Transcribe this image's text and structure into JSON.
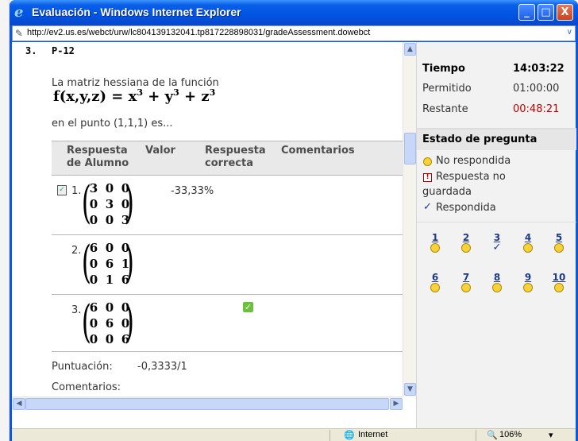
{
  "window": {
    "title": "Evaluación - Windows Internet Explorer",
    "minimize": "_",
    "maximize": "□",
    "close": "X"
  },
  "address": {
    "url": "http://ev2.us.es/webct/urw/lc804139132041.tp817228898031/gradeAssessment.dowebct"
  },
  "question": {
    "number": "3.",
    "id": "P-12",
    "text1": "La matriz hessiana de la función",
    "formula_fxyz": "f(x,y,z) = x",
    "formula_y": " + y",
    "formula_z": " + z",
    "formula_exp": "3",
    "text2": "en el punto (1,1,1) es...",
    "table": {
      "headers": {
        "student_answer": [
          "Respuesta",
          "de Alumno"
        ],
        "value": "Valor",
        "correct_answer": [
          "Respuesta",
          "correcta"
        ],
        "comments": "Comentarios"
      },
      "rows": [
        {
          "num": "1.",
          "matrix": [
            [
              "3",
              "0",
              "0"
            ],
            [
              "0",
              "3",
              "0"
            ],
            [
              "0",
              "0",
              "3"
            ]
          ],
          "value": "-33,33%",
          "selected": true,
          "correct": false
        },
        {
          "num": "2.",
          "matrix": [
            [
              "6",
              "0",
              "0"
            ],
            [
              "0",
              "6",
              "1"
            ],
            [
              "0",
              "1",
              "6"
            ]
          ],
          "value": "",
          "selected": false,
          "correct": false
        },
        {
          "num": "3.",
          "matrix": [
            [
              "6",
              "0",
              "0"
            ],
            [
              "0",
              "6",
              "0"
            ],
            [
              "0",
              "0",
              "6"
            ]
          ],
          "value": "",
          "selected": false,
          "correct": true
        }
      ]
    },
    "score_label": "Puntuación:",
    "score_value": "-0,3333/1",
    "comments_label": "Comentarios:"
  },
  "side": {
    "time_label": "Tiempo",
    "time_value": "14:03:22",
    "allowed_label": "Permitido",
    "allowed_value": "01:00:00",
    "remaining_label": "Restante",
    "remaining_value": "00:48:21",
    "status_title": "Estado de pregunta",
    "legend_unanswered": "No respondida",
    "legend_unsaved_1": "Respuesta no",
    "legend_unsaved_2": "guardada",
    "legend_answered": "Respondida",
    "questions": [
      {
        "num": "1",
        "state": "unanswered"
      },
      {
        "num": "2",
        "state": "unanswered"
      },
      {
        "num": "3",
        "state": "answered"
      },
      {
        "num": "4",
        "state": "unanswered"
      },
      {
        "num": "5",
        "state": "unanswered"
      },
      {
        "num": "6",
        "state": "unanswered"
      },
      {
        "num": "7",
        "state": "unanswered"
      },
      {
        "num": "8",
        "state": "unanswered"
      },
      {
        "num": "9",
        "state": "unanswered"
      },
      {
        "num": "10",
        "state": "unanswered"
      }
    ]
  },
  "statusbar": {
    "zone": "Internet",
    "zoom": "106%"
  },
  "colors": {
    "titlebar": "#0054e3",
    "remaining": "#c00000",
    "link": "#1e3a8a",
    "unanswered_dot": "#f8d23a",
    "correct_check": "#6cc13c"
  }
}
